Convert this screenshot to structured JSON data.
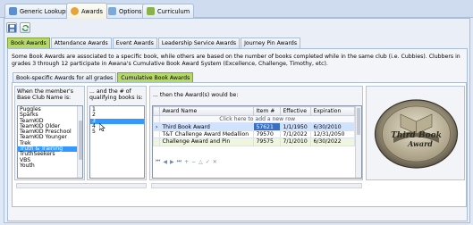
{
  "top_tabs": [
    {
      "label": "Generic Lookups",
      "icon": "lookup-icon",
      "color": "#5d8fd0"
    },
    {
      "label": "Awards",
      "icon": "award-icon",
      "color": "#e6a33a"
    },
    {
      "label": "Options",
      "icon": "options-icon",
      "color": "#7aa9dc"
    },
    {
      "label": "Curriculum",
      "icon": "curriculum-icon",
      "color": "#8bb24a"
    }
  ],
  "toolbar": {
    "save_icon": "save-icon",
    "refresh_icon": "refresh-icon"
  },
  "subtabs": [
    "Book Awards",
    "Attendance Awards",
    "Event Awards",
    "Leadership Service Awards",
    "Journey Pin Awards"
  ],
  "description": "Some Book Awards are associated to a specific book, while others are based on the number of books completed while in the same club (i.e. Cubbies).   Clubbers in grades 3 through 12 participate in Awana's Cumulative Book Award System (Excellence, Challenge, Timothy, etc).",
  "inner_tabs": [
    "Book-specific Awards for all grades",
    "Cumulative Book Awards"
  ],
  "club_box": {
    "caption": "When the member's Base Club Name is:",
    "items": [
      "Puggles",
      "Sparks",
      "TeamKID",
      "TeamKID Older",
      "TeamKID Preschool",
      "TeamKID Younger",
      "Trek",
      "Truth & Training",
      "TruthSeekers",
      "VBS",
      "Youth"
    ],
    "selected": "Truth & Training"
  },
  "books_box": {
    "caption": "... and the # of qualifying books is:",
    "items": [
      "1",
      "2",
      "3",
      "4",
      "5"
    ],
    "selected": "3"
  },
  "awards_box": {
    "caption": "... then the Award(s) would be:",
    "columns": [
      "Award Name",
      "Item #",
      "Effective",
      "Expiration"
    ],
    "add_row": "Click here to add a new row",
    "rows": [
      {
        "name": "Third Book Award",
        "item": "57621",
        "effective": "1/1/1950",
        "expiration": "6/30/2010"
      },
      {
        "name": "T&T Challenge Award Medallion",
        "item": "79570",
        "effective": "7/1/2022",
        "expiration": "12/31/2050"
      },
      {
        "name": "Challenge Award and Pin",
        "item": "79575",
        "effective": "7/1/2010",
        "expiration": "6/30/2022"
      }
    ]
  },
  "medallion": {
    "line1": "Third Book",
    "line2": "Award"
  }
}
